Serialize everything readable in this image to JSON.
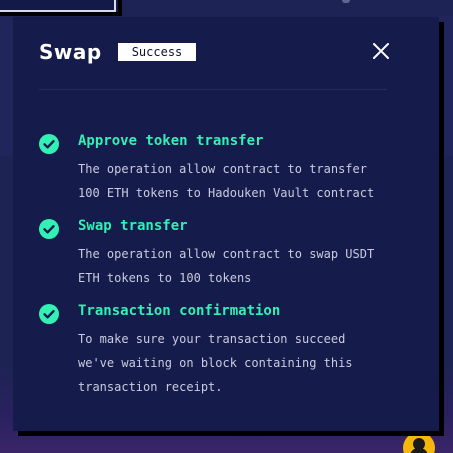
{
  "modal": {
    "title": "Swap",
    "status": "Success"
  },
  "steps": [
    {
      "title": "Approve token transfer",
      "lines": [
        "The operation allow contract to transfer",
        "100 ETH tokens to Hadouken Vault contract"
      ]
    },
    {
      "title": "Swap transfer",
      "lines": [
        "The operation allow contract to swap USDT",
        "ETH tokens to 100 tokens"
      ]
    },
    {
      "title": "Transaction confirmation",
      "lines": [
        "To make sure your transaction succeed",
        "we've waiting on block containing this",
        "transaction receipt."
      ]
    }
  ],
  "colors": {
    "accent": "#33f0b4",
    "modal_bg": "#151b4a",
    "page_bg": "#1d2354",
    "avatar": "#f5b80a"
  },
  "icons": {
    "close": "close-icon",
    "check": "check-circle-icon",
    "avatar": "user-avatar-icon"
  }
}
